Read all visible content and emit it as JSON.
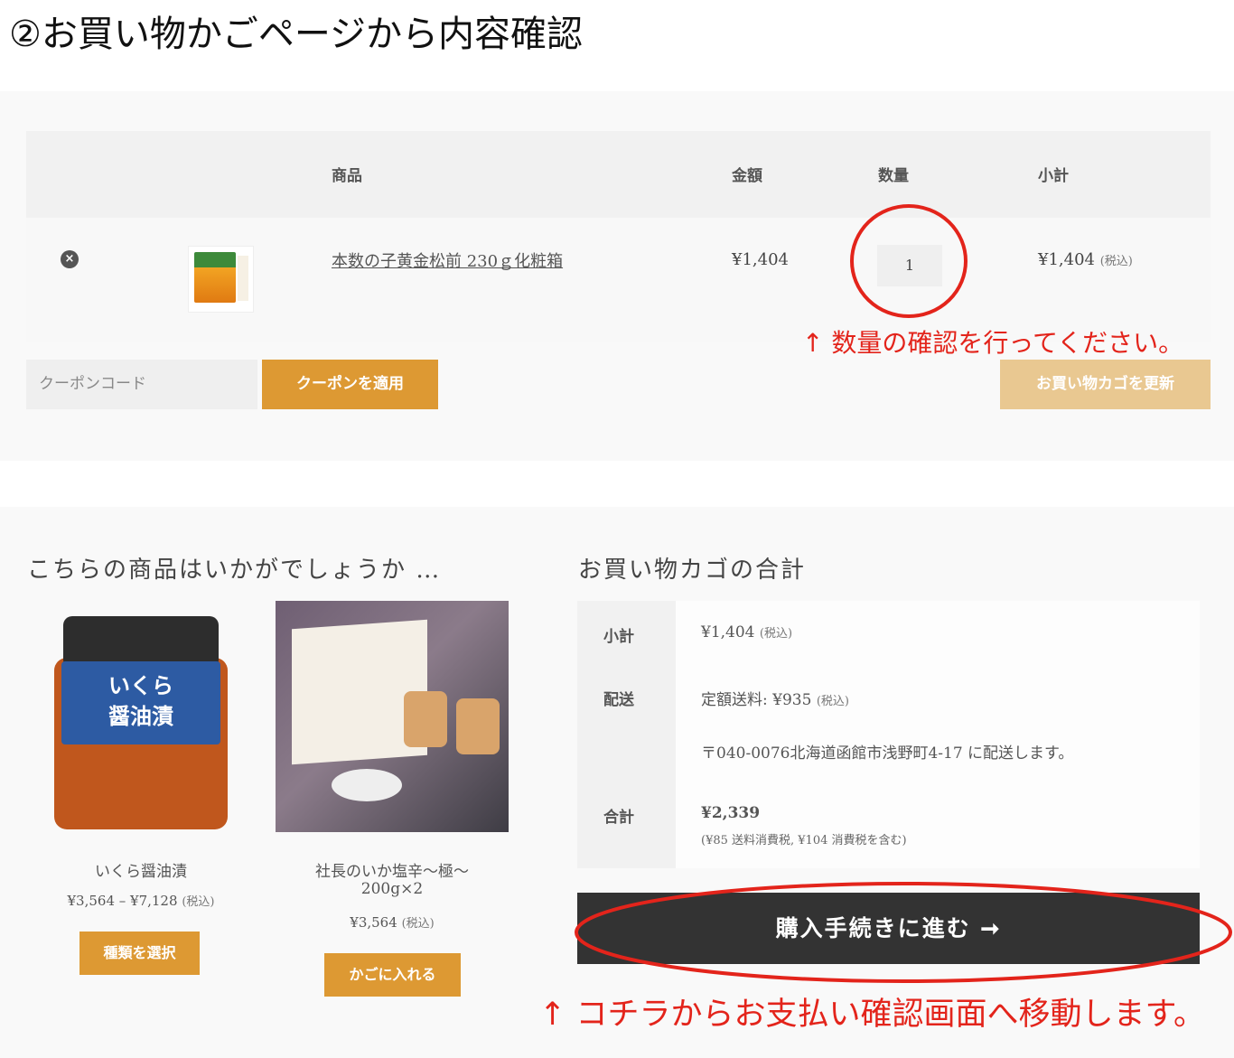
{
  "heading": "②お買い物かごページから内容確認",
  "cart": {
    "headers": {
      "product": "商品",
      "price": "金額",
      "quantity": "数量",
      "subtotal": "小計"
    },
    "item": {
      "remove_icon": "×",
      "name": "本数の子黄金松前 230ｇ化粧箱",
      "price": "¥1,404",
      "quantity": "1",
      "subtotal": "¥1,404",
      "tax_note": "(税込)"
    },
    "coupon_placeholder": "クーポンコード",
    "coupon_button": "クーポンを適用",
    "update_button": "お買い物カゴを更新"
  },
  "recommend": {
    "title": "こちらの商品はいかがでしょうか …",
    "products": [
      {
        "image_label": "いくら\n醤油漬",
        "name": "いくら醤油漬",
        "price": "¥3,564 – ¥7,128",
        "tax": "(税込)",
        "button": "種類を選択"
      },
      {
        "name_line1": "社長のいか塩辛～極～",
        "name_line2": "200g×2",
        "price": "¥3,564",
        "tax": "(税込)",
        "button": "かごに入れる"
      }
    ]
  },
  "totals": {
    "title": "お買い物カゴの合計",
    "subtotal_label": "小計",
    "subtotal_value": "¥1,404",
    "shipping_label": "配送",
    "shipping_value": "定額送料: ¥935",
    "shipping_address": "〒040-0076北海道函館市浅野町4-17 に配送します。",
    "total_label": "合計",
    "total_value": "¥2,339",
    "total_note": "(¥85 送料消費税, ¥104 消費税を含む)",
    "tax": "(税込)"
  },
  "checkout_button": "購入手続きに進む ➞",
  "annotations": {
    "qty_note": "↑ 数量の確認を行ってください。",
    "checkout_note": "↑ コチラからお支払い確認画面へ移動します。",
    "color": "#e3241b"
  }
}
